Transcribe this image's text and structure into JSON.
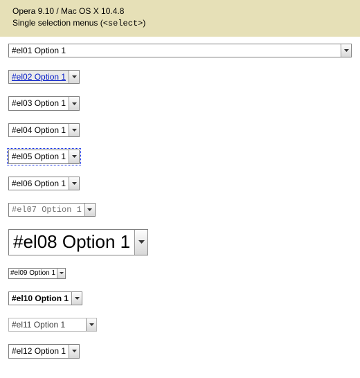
{
  "header": {
    "title_line1": "Opera 9.10 / Mac OS X 10.4.8",
    "title_line2_pre": "Single selection menus (",
    "title_line2_code": "<select>",
    "title_line2_post": ")"
  },
  "selects": {
    "el01": "#el01 Option 1",
    "el02": "#el02 Option 1",
    "el03": "#el03 Option 1",
    "el04": "#el04 Option 1",
    "el05": "#el05 Option 1",
    "el06": "#el06 Option 1",
    "el07": "#el07 Option 1",
    "el08": "#el08 Option 1",
    "el09": "#el09 Option 1",
    "el10": "#el10 Option 1",
    "el11": "#el11 Option 1",
    "el12": "#el12 Option 1"
  }
}
